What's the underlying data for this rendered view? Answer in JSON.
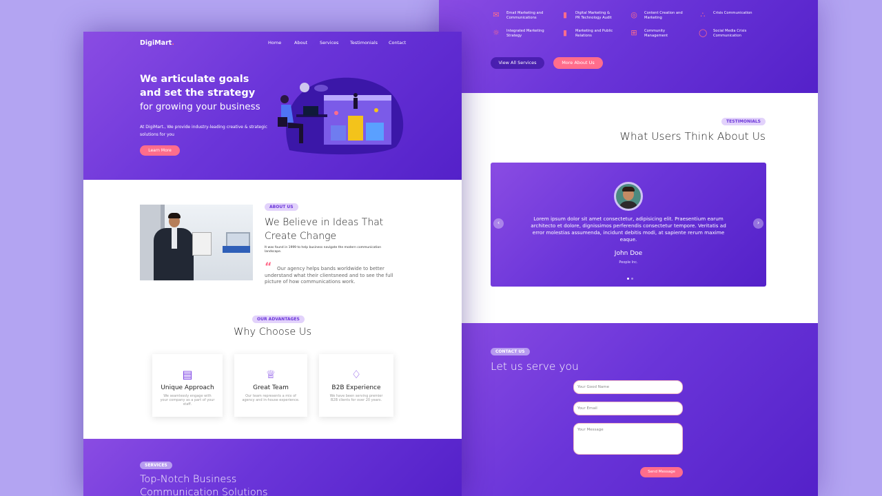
{
  "right": {
    "services": [
      {
        "icon": "mail-icon",
        "label": "Email Marketing and Communications"
      },
      {
        "icon": "bar-chart-icon",
        "label": "Digital Marketing & PR Technology Audit"
      },
      {
        "icon": "globe-icon",
        "label": "Content Creation and Marketing"
      },
      {
        "icon": "nodes-icon",
        "label": "Crisis Communication"
      },
      {
        "icon": "sun-icon",
        "label": "Integrated Marketing Strategy"
      },
      {
        "icon": "bar-chart-icon",
        "label": "Marketing and Public Relations"
      },
      {
        "icon": "grid-icon",
        "label": "Community Management"
      },
      {
        "icon": "chat-bubble-icon",
        "label": "Social Media Crisis Communication"
      }
    ],
    "view_all_label": "View All Services",
    "more_about_label": "More About Us",
    "testimonials": {
      "badge": "Testimonials",
      "title": "What Users Think About Us",
      "quote": "Lorem ipsum dolor sit amet consectetur, adipisicing elit. Praesentium earum architecto et dolore, dignissimos perferendis consectetur tempore. Veritatis ad error molestias assumenda, incidunt debitis modi, at sapiente rerum maxime eaque.",
      "name": "John Doe",
      "company": "People Inc."
    },
    "contact": {
      "badge": "Contact Us",
      "title": "Let us serve you",
      "name_placeholder": "Your Good Name",
      "email_placeholder": "Your Email",
      "message_placeholder": "Your Message",
      "send_label": "Send Message"
    }
  },
  "left": {
    "brand": "DigiMart.",
    "brand_main": "DigiMart",
    "brand_dot": ".",
    "nav": [
      "Home",
      "About",
      "Services",
      "Testimonials",
      "Contact"
    ],
    "hero": {
      "line1": "We articulate goals",
      "line2": "and set the strategy",
      "line3": "for growing your business",
      "desc": "At DigiMart., We provide industry-leading creative & strategic solutions for you",
      "cta": "Learn More"
    },
    "about": {
      "badge": "About Us",
      "title": "We Believe in Ideas That Create Change",
      "small": "It was found in 1999 to help business navigate the modern communication landscape.",
      "quote": "Our agency helps bands worldwide to better understand what their clientsneed and to see the full picture of how communications work."
    },
    "advantages": {
      "badge": "Our Advantages",
      "title": "Why Choose Us",
      "cards": [
        {
          "icon": "briefcase-icon",
          "title": "Unique Approach",
          "desc": "We seamlessly engage with your company as a part of your staff."
        },
        {
          "icon": "crown-icon",
          "title": "Great Team",
          "desc": "Our team represents a mix of agency and in-house experience."
        },
        {
          "icon": "diamond-icon",
          "title": "B2B Experience",
          "desc": "We have been serving premier B2B clients for over 20 years."
        }
      ]
    },
    "services": {
      "badge": "Services",
      "title_line1": "Top-Notch Business",
      "title_line2": "Communication Solutions"
    }
  },
  "colors": {
    "accent": "#ff6d8c",
    "purple": "#6b35d9",
    "lavender": "#b3a4f2"
  }
}
